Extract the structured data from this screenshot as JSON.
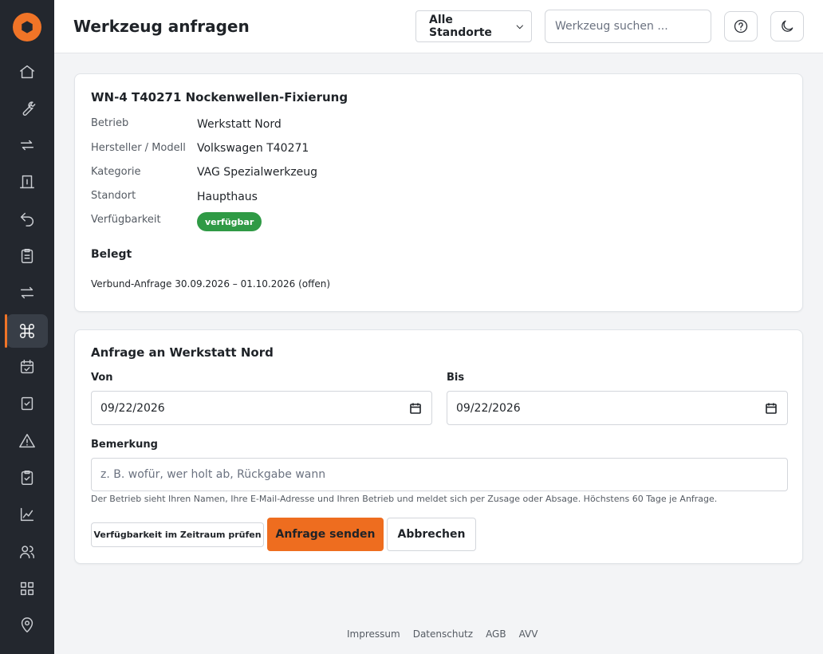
{
  "header": {
    "title": "Werkzeug anfragen",
    "location_select": "Alle Standorte",
    "search_placeholder": "Werkzeug suchen ..."
  },
  "sidebar": {
    "items": [
      {
        "icon": "home-icon"
      },
      {
        "icon": "wrench-icon"
      },
      {
        "icon": "swap-icon"
      },
      {
        "icon": "checkout-icon"
      },
      {
        "icon": "return-icon"
      },
      {
        "icon": "clipboard-list-icon"
      },
      {
        "icon": "transfer-icon"
      },
      {
        "icon": "command-icon",
        "active": true
      },
      {
        "icon": "calendar-check-icon"
      },
      {
        "icon": "checkbox-icon"
      },
      {
        "icon": "warning-icon"
      },
      {
        "icon": "clipboard-check-icon"
      },
      {
        "icon": "chart-icon"
      },
      {
        "icon": "users-icon"
      },
      {
        "icon": "grid-icon"
      },
      {
        "icon": "location-pin-icon"
      }
    ]
  },
  "tool": {
    "title": "WN-4 T40271 Nockenwellen-Fixierung",
    "details": [
      {
        "label": "Betrieb",
        "value": "Werkstatt Nord"
      },
      {
        "label": "Hersteller / Modell",
        "value": "Volkswagen T40271"
      },
      {
        "label": "Kategorie",
        "value": "VAG Spezialwerkzeug"
      },
      {
        "label": "Standort",
        "value": "Haupthaus"
      },
      {
        "label": "Verfügbarkeit",
        "value": "verfügbar"
      }
    ],
    "availability_color": "#2f9a45",
    "booked_title": "Belegt",
    "booked_entry": "Verbund-Anfrage 30.09.2026 – 01.10.2026 (offen)"
  },
  "request": {
    "title": "Anfrage an Werkstatt Nord",
    "from_label": "Von",
    "from_value": "09/22/2026",
    "to_label": "Bis",
    "to_value": "09/22/2026",
    "remark_label": "Bemerkung",
    "remark_placeholder": "z. B. wofür, wer holt ab, Rückgabe wann",
    "hint": "Der Betrieb sieht Ihren Namen, Ihre E-Mail-Adresse und Ihren Betrieb und meldet sich per Zusage oder Absage. Höchstens 60 Tage je Anfrage.",
    "check_button": "Verfügbarkeit im Zeitraum prüfen",
    "send_button": "Anfrage senden",
    "cancel_button": "Abbrechen",
    "accent_color": "#ee6d1f"
  },
  "footer": {
    "links": [
      "Impressum",
      "Datenschutz",
      "AGB",
      "AVV"
    ]
  }
}
